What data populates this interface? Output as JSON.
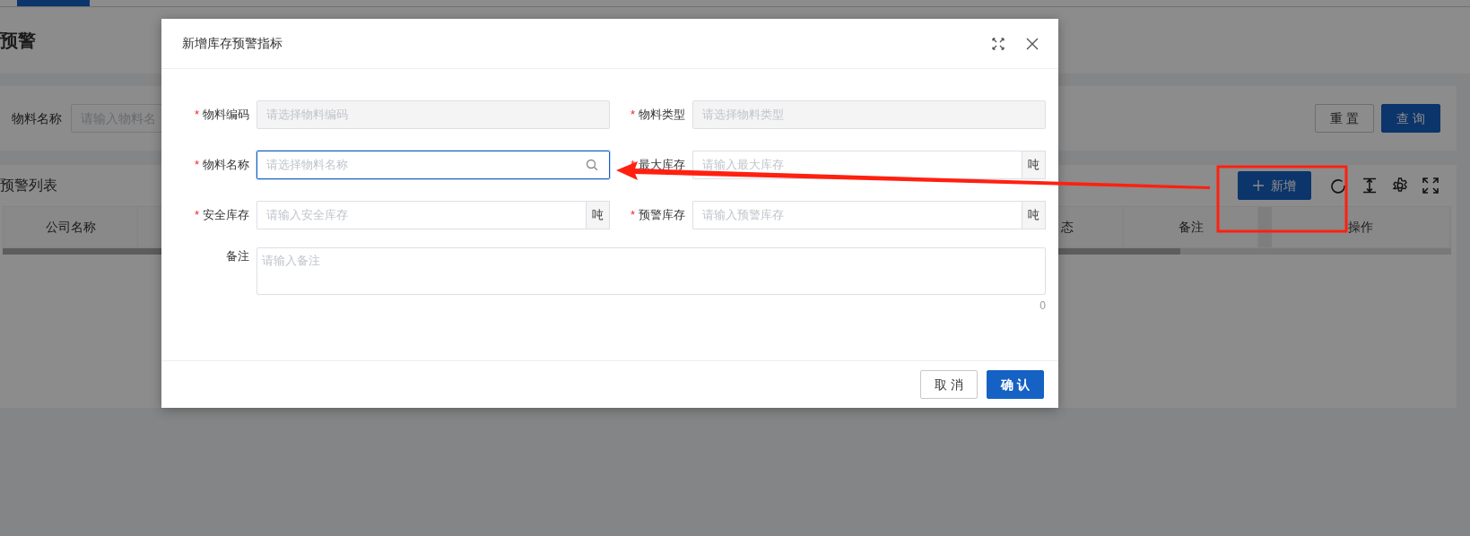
{
  "tab_strip": {
    "tabs": [
      {
        "selected": true
      }
    ]
  },
  "page": {
    "title": "预警",
    "search": {
      "fields": [
        {
          "label": "物料名称",
          "placeholder": "请输入物料名"
        }
      ],
      "buttons": [
        {
          "label": "重 置",
          "kind": "default"
        },
        {
          "label": "查 询",
          "kind": "primary"
        }
      ]
    },
    "table": {
      "title": "预警列表",
      "add_button": "新增",
      "columns": [
        {
          "label": "公司名称",
          "kind": "lead"
        },
        {
          "label": "态",
          "kind": "tail"
        },
        {
          "label": "备注",
          "kind": "normal"
        },
        {
          "label": "操作",
          "kind": "fixed"
        }
      ]
    }
  },
  "dialog": {
    "title": "新增库存预警指标",
    "fields": [
      {
        "label": "物料编码",
        "required_mark": "*",
        "kind": "disabled",
        "placeholder": "请选择物料编码",
        "focused": false
      },
      {
        "label": "物料类型",
        "required_mark": "*",
        "kind": "disabled",
        "placeholder": "请选择物料类型",
        "focused": false
      },
      {
        "label": "物料名称",
        "required_mark": "*",
        "kind": "search",
        "placeholder": "请选择物料名称",
        "focused": true
      },
      {
        "label": "最大库存",
        "required_mark": "*",
        "kind": "unit",
        "placeholder": "请输入最大库存",
        "unit": "吨",
        "focused": false
      },
      {
        "label": "安全库存",
        "required_mark": "*",
        "kind": "unit",
        "placeholder": "请输入安全库存",
        "unit": "吨",
        "focused": false
      },
      {
        "label": "预警库存",
        "required_mark": "*",
        "kind": "unit",
        "placeholder": "请输入预警库存",
        "unit": "吨",
        "focused": false
      }
    ],
    "remark": {
      "label": "备注",
      "placeholder": "请输入备注",
      "count": "0"
    },
    "buttons": [
      {
        "label": "取 消",
        "kind": "default"
      },
      {
        "label": "确 认",
        "kind": "primary"
      }
    ]
  },
  "annotations": {
    "arrow": true,
    "frame": true
  }
}
